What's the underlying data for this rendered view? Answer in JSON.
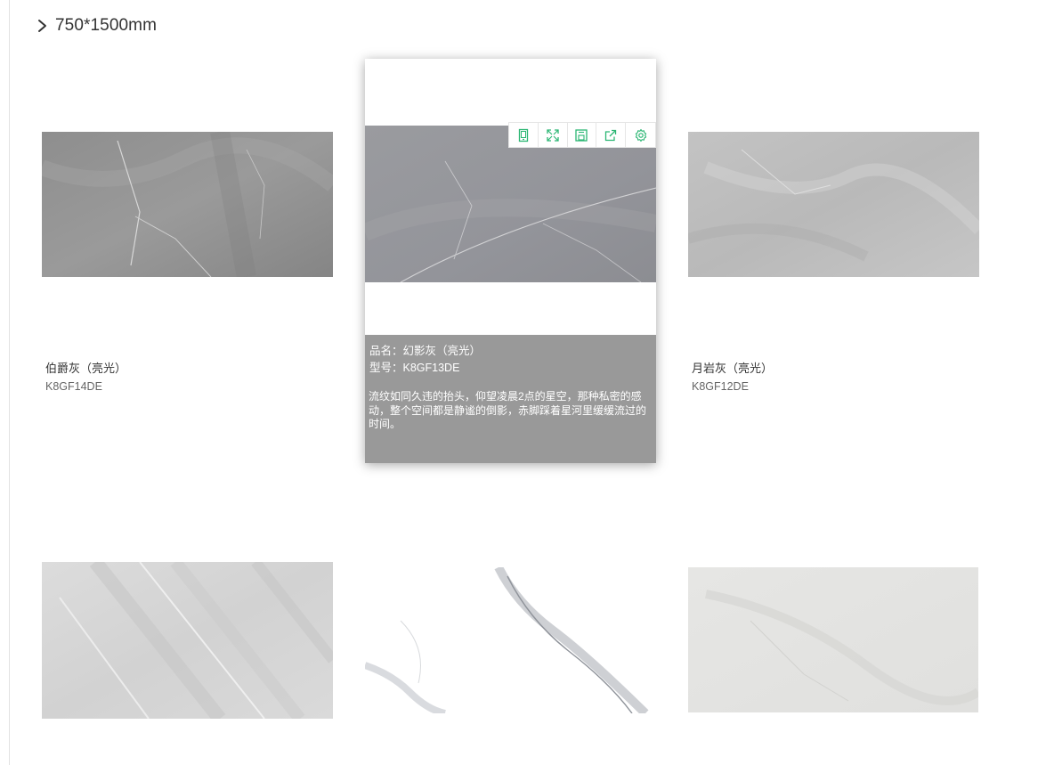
{
  "section": {
    "title": "750*1500mm"
  },
  "products": [
    {
      "name": "伯爵灰（亮光）",
      "code": "K8GF14DE"
    },
    {
      "name": "幻影灰（亮光）",
      "code": "K8GF13DE"
    },
    {
      "name": "月岩灰（亮光）",
      "code": "K8GF12DE"
    },
    {
      "name": "",
      "code": ""
    },
    {
      "name": "",
      "code": ""
    },
    {
      "name": "",
      "code": ""
    }
  ],
  "hover_card": {
    "name_line": "品名：幻影灰（亮光）",
    "code_line": "型号：K8GF13DE",
    "description": "流纹如同久违的抬头，仰望凌晨2点的星空，那种私密的感动，整个空间都是静谧的倒影，赤脚踩着星河里缓缓流过的时间。"
  },
  "toolbar": {
    "icons": [
      "tablet-icon",
      "fullscreen-icon",
      "save-icon",
      "share-icon",
      "settings-icon"
    ],
    "accent_color": "#2bb673"
  },
  "colors": {
    "card_info_bg": "#999999",
    "divider": "#e2e2e2"
  }
}
